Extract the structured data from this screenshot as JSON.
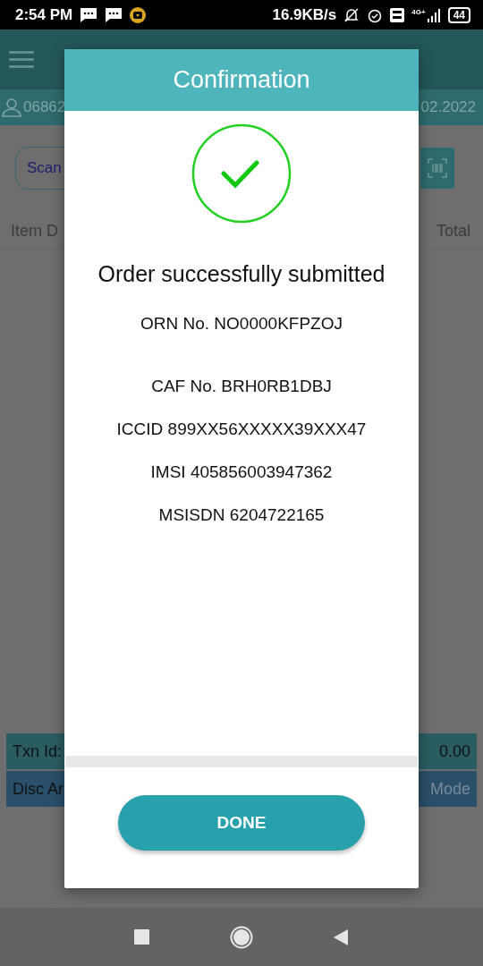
{
  "status_bar": {
    "time": "2:54 PM",
    "speed": "16.9KB/s",
    "network": "4G+",
    "battery": "44"
  },
  "app_bar": {
    "user_id": "06862",
    "date": "02.2022"
  },
  "scan_field": {
    "value": "Scan"
  },
  "table": {
    "columns": [
      "Item D",
      "Total"
    ]
  },
  "summary": [
    {
      "label": "Txn Id:",
      "value": "0.00",
      "kind": "txn"
    },
    {
      "label": "Disc Ar",
      "value": "Mode",
      "kind": "disc"
    }
  ],
  "dialog": {
    "title": "Confirmation",
    "message": "Order successfully submitted",
    "details": [
      "ORN No. NO0000KFPZOJ",
      "CAF No. BRH0RB1DBJ",
      "ICCID 899XX56XXXXX39XXX47",
      "IMSI 405856003947362",
      "MSISDN 6204722165"
    ],
    "button": "DONE"
  }
}
